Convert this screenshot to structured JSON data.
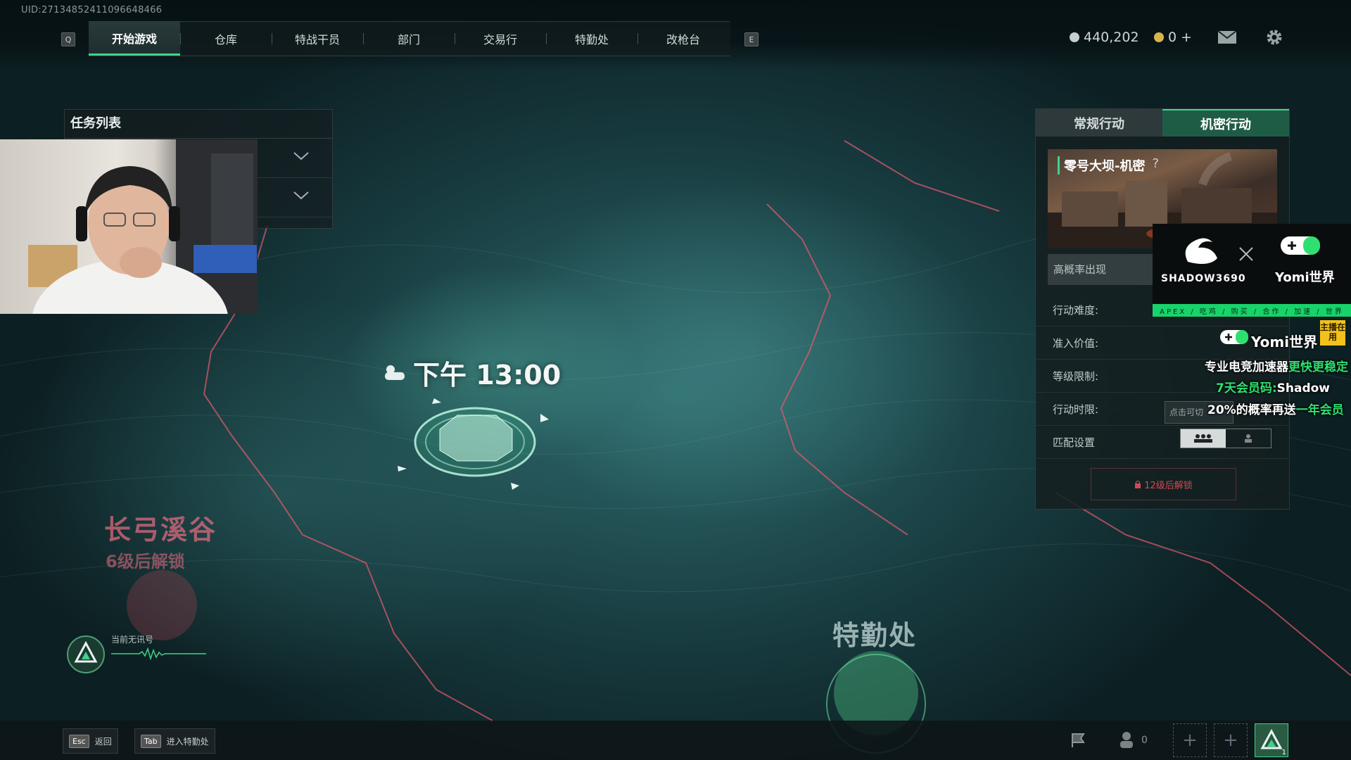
{
  "uid": "UID:271348524110966484​66",
  "nav": {
    "left_key": "Q",
    "right_key": "E",
    "items": [
      "开始游戏",
      "仓库",
      "特战干员",
      "部门",
      "交易行",
      "特勤处",
      "改枪台"
    ],
    "active_index": 0
  },
  "currency": {
    "silver": "440,202",
    "gold": "0 +"
  },
  "mission_list": {
    "title": "任务列表"
  },
  "map": {
    "time": "下午 13:00",
    "zone_name": "长弓溪谷",
    "zone_lock": "6级后解锁",
    "special_label": "特勤处",
    "signal": "当前无讯号"
  },
  "ops_panel": {
    "tabs": [
      "常规行动",
      "机密行动"
    ],
    "active_tab": 1,
    "map_title": "零号大坝-机密",
    "map_help": "?",
    "prob_label": "高概率出现",
    "rows": [
      "行动难度:",
      "准入价值:",
      "等级限制:",
      "行动时限:",
      "匹配设置"
    ],
    "hint_tooltip": "点击可切",
    "unlock": "12级后解锁"
  },
  "sponsor": {
    "brand1": "SHADOW3690",
    "brand2": "Yomi世界",
    "bar": "APEX / 吃鸡 / 购买 / 合作 / 加速 / 世界",
    "logo_line": "Yomi世界",
    "badge": "主播在用",
    "line1_a": "专业电竞加速器",
    "line1_b": "更快更稳定",
    "line2_a": "7天会员码:",
    "line2_b": "Shadow",
    "line3_a": "20%的概率再送",
    "line3_b": "一年会员"
  },
  "bottom": {
    "esc_key": "Esc",
    "esc_label": "返回",
    "tab_key": "Tab",
    "tab_label": "进入特勤处",
    "team_count": "0",
    "level": "1"
  },
  "colors": {
    "accent": "#3fd28a",
    "lock_red": "#d04a55",
    "sponsor_green": "#17d36a"
  }
}
